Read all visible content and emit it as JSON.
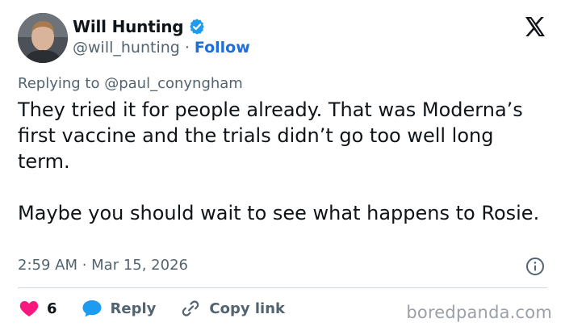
{
  "author": {
    "display_name": "Will Hunting",
    "handle": "@will_hunting",
    "separator": "·",
    "follow_label": "Follow"
  },
  "reply_context": {
    "text": "Replying to @paul_conyngham"
  },
  "tweet": {
    "paragraphs": [
      "They tried it for people already. That was Moderna’s first vaccine and the trials didn’t go too well long term.",
      "Maybe you should wait to see what happens to Rosie."
    ],
    "timestamp": "2:59 AM · Mar 15, 2026"
  },
  "actions": {
    "like_count": "6",
    "reply_label": "Reply",
    "copy_link_label": "Copy link"
  },
  "watermark": {
    "text": "boredpanda.com"
  },
  "icons": {
    "verified": "verified-badge-icon",
    "platform": "x-logo-icon",
    "info": "info-icon",
    "like": "heart-icon",
    "reply": "speech-bubble-icon",
    "copy_link": "link-icon"
  },
  "colors": {
    "verified_blue": "#1d9bf0",
    "follow_blue": "#1d6ddb",
    "heart_pink": "#f91880",
    "reply_blue": "#1d9bf0",
    "secondary_text": "#536471",
    "primary_text": "#0f1419"
  }
}
